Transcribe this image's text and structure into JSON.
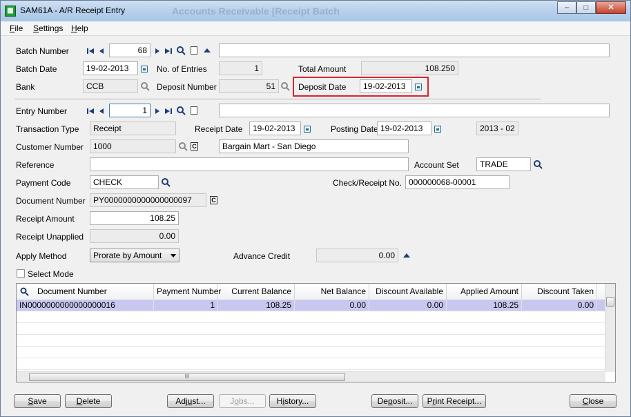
{
  "window": {
    "title": "SAM61A - A/R Receipt Entry",
    "background_title": "Accounts Receivable [Receipt Batch",
    "min_glyph": "–",
    "max_glyph": "□",
    "close_glyph": "✕"
  },
  "menu": [
    {
      "key": "F",
      "rest": "ile"
    },
    {
      "key": "S",
      "rest": "ettings"
    },
    {
      "key": "H",
      "rest": "elp"
    }
  ],
  "batch": {
    "number_label": "Batch Number",
    "number": "68",
    "description": "",
    "date_label": "Batch Date",
    "date": "19-02-2013",
    "entries_label": "No. of Entries",
    "entries": "1",
    "total_label": "Total Amount",
    "total": "108.250",
    "bank_label": "Bank",
    "bank": "CCB",
    "deposit_number_label": "Deposit Number",
    "deposit_number": "51",
    "deposit_date_label": "Deposit Date",
    "deposit_date": "19-02-2013"
  },
  "entry": {
    "number_label": "Entry Number",
    "number": "1",
    "description": "",
    "transaction_type_label": "Transaction Type",
    "transaction_type": "Receipt",
    "receipt_date_label": "Receipt Date",
    "receipt_date": "19-02-2013",
    "posting_date_label": "Posting Date",
    "posting_date": "19-02-2013",
    "period": "2013 - 02",
    "customer_number_label": "Customer Number",
    "customer_number": "1000",
    "customer_name": "Bargain Mart - San Diego",
    "reference_label": "Reference",
    "reference": "",
    "account_set_label": "Account Set",
    "account_set": "TRADE",
    "payment_code_label": "Payment Code",
    "payment_code": "CHECK",
    "check_receipt_label": "Check/Receipt No.",
    "check_receipt": "000000068-00001",
    "document_number_label": "Document Number",
    "document_number": "PY0000000000000000097",
    "receipt_amount_label": "Receipt Amount",
    "receipt_amount": "108.25",
    "receipt_unapplied_label": "Receipt Unapplied",
    "receipt_unapplied": "0.00",
    "apply_method_label": "Apply Method",
    "apply_method": "Prorate by Amount",
    "advance_credit_label": "Advance Credit",
    "advance_credit": "0.00",
    "select_mode_label": "Select Mode",
    "select_mode_checked": false
  },
  "grid": {
    "columns": [
      "Document Number",
      "Payment Number",
      "Current Balance",
      "Net Balance",
      "Discount Available",
      "Applied Amount",
      "Discount Taken"
    ],
    "rows": [
      [
        "IN0000000000000000016",
        "1",
        "108.25",
        "0.00",
        "0.00",
        "108.25",
        "0.00"
      ]
    ],
    "scroll_glyph": "III"
  },
  "buttons": {
    "save": {
      "key": "S",
      "rest": "ave"
    },
    "delete": {
      "key": "D",
      "rest": "elete"
    },
    "adjust": {
      "pre": "Adj",
      "key": "u",
      "rest": "st..."
    },
    "jobs": {
      "pre": "J",
      "key": "o",
      "rest": "bs..."
    },
    "history": {
      "pre": "H",
      "key": "i",
      "rest": "story..."
    },
    "deposit": {
      "pre": "De",
      "key": "p",
      "rest": "osit..."
    },
    "print_receipt": {
      "pre": "P",
      "key": "r",
      "rest": "int Receipt..."
    },
    "close": {
      "key": "C",
      "rest": "lose"
    }
  },
  "icon_names": {
    "first": "first-record-icon",
    "prev": "previous-record-icon",
    "next": "next-record-icon",
    "last": "last-record-icon",
    "finder": "magnifier-icon",
    "new": "new-document-icon",
    "calendar": "calendar-icon",
    "zoom": "zoom-icon",
    "collapse": "collapse-up-icon"
  }
}
